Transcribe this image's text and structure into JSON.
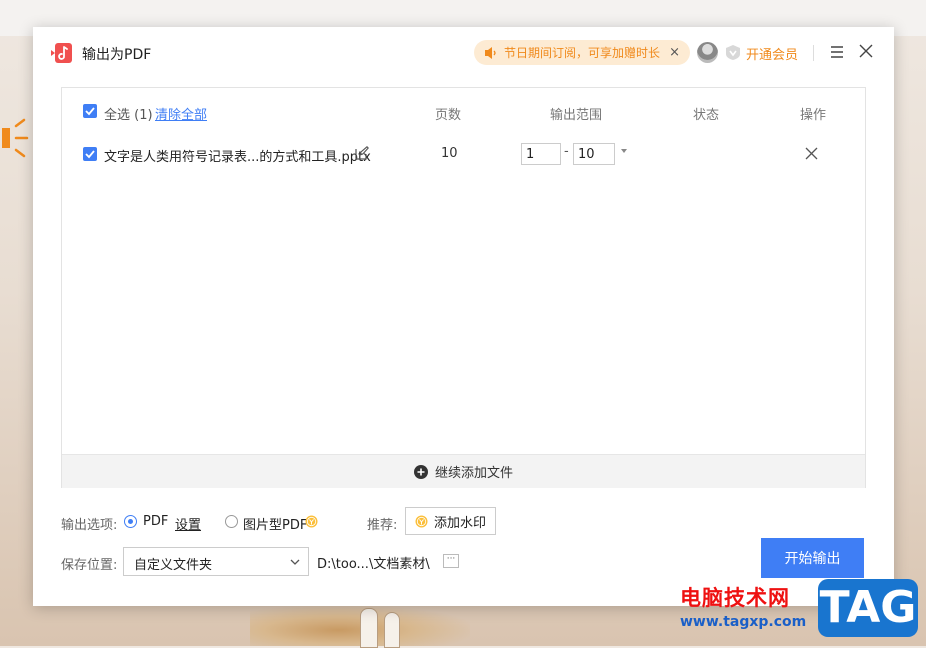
{
  "dialog": {
    "title": "输出为PDF",
    "promo_text": "节日期间订阅，可享加赠时长",
    "promo_close": "×",
    "vip_label": "开通会员"
  },
  "table": {
    "select_all_label": "全选 (1)",
    "clear_all_label": "清除全部",
    "columns": {
      "pages": "页数",
      "range": "输出范围",
      "status": "状态",
      "action": "操作"
    },
    "rows": [
      {
        "checked": true,
        "filename": "文字是人类用符号记录表...的方式和工具.pptx",
        "pages": "10",
        "range_from": "1",
        "range_to": "10",
        "status": ""
      }
    ]
  },
  "add_more_label": "继续添加文件",
  "options": {
    "label": "输出选项:",
    "pdf_label": "PDF",
    "settings_label": "设置",
    "image_pdf_label": "图片型PDF",
    "selected": "PDF",
    "recommend_label": "推荐:",
    "watermark_label": "添加水印"
  },
  "save": {
    "label": "保存位置:",
    "location_option": "自定义文件夹",
    "path": "D:\\too...\\文档素材\\",
    "more_label": "···"
  },
  "start_label": "开始输出",
  "watermark": {
    "site_name": "电脑技术网",
    "site_url": "www.tagxp.com",
    "tag": "TAG"
  },
  "colors": {
    "accent": "#3f7ef5",
    "promo_text": "#f08a1c",
    "promo_bg": "#fdebd3",
    "watermark_red": "#e11111",
    "watermark_blue": "#1975cf"
  },
  "icons": [
    "pdf-app-icon",
    "speaker-icon",
    "close-icon",
    "avatar",
    "vip-coin-icon",
    "menu-icon",
    "checkbox-icon",
    "edit-icon",
    "dropdown-caret-icon",
    "remove-icon",
    "plus-circle-icon",
    "coin-icon",
    "chevron-down-icon"
  ]
}
